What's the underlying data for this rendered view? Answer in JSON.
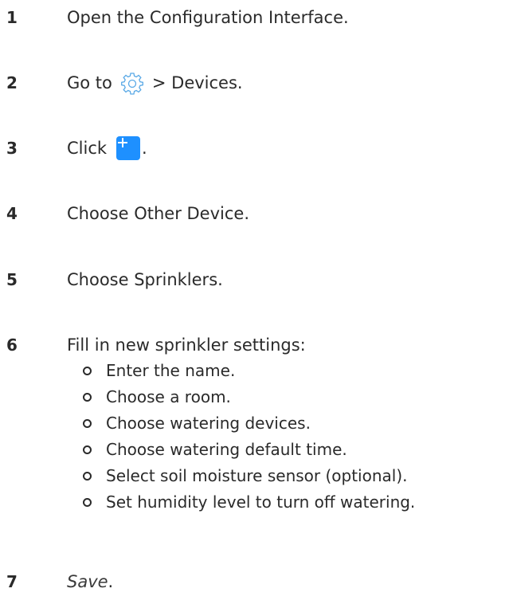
{
  "steps": [
    {
      "num": "1",
      "text": "Open the Configuration Interface."
    },
    {
      "num": "2",
      "before": "Go to",
      "icon": "gear-icon",
      "after": "> Devices."
    },
    {
      "num": "3",
      "before": "Click",
      "icon": "plus-icon",
      "after": "."
    },
    {
      "num": "4",
      "text": "Choose Other Device."
    },
    {
      "num": "5",
      "text": "Choose Sprinklers."
    },
    {
      "num": "6",
      "text": "Fill in new sprinkler settings:"
    },
    {
      "num": "7",
      "italic": "Save",
      "after": "."
    }
  ],
  "substeps": [
    "Enter the name.",
    "Choose a room.",
    "Choose watering devices.",
    "Choose watering default time.",
    "Select soil moisture sensor (optional).",
    "Set humidity level to turn off watering."
  ],
  "colors": {
    "text": "#2a2a2a",
    "accent_button": "#1e90ff",
    "gear_icon": "#5aa9e6"
  }
}
